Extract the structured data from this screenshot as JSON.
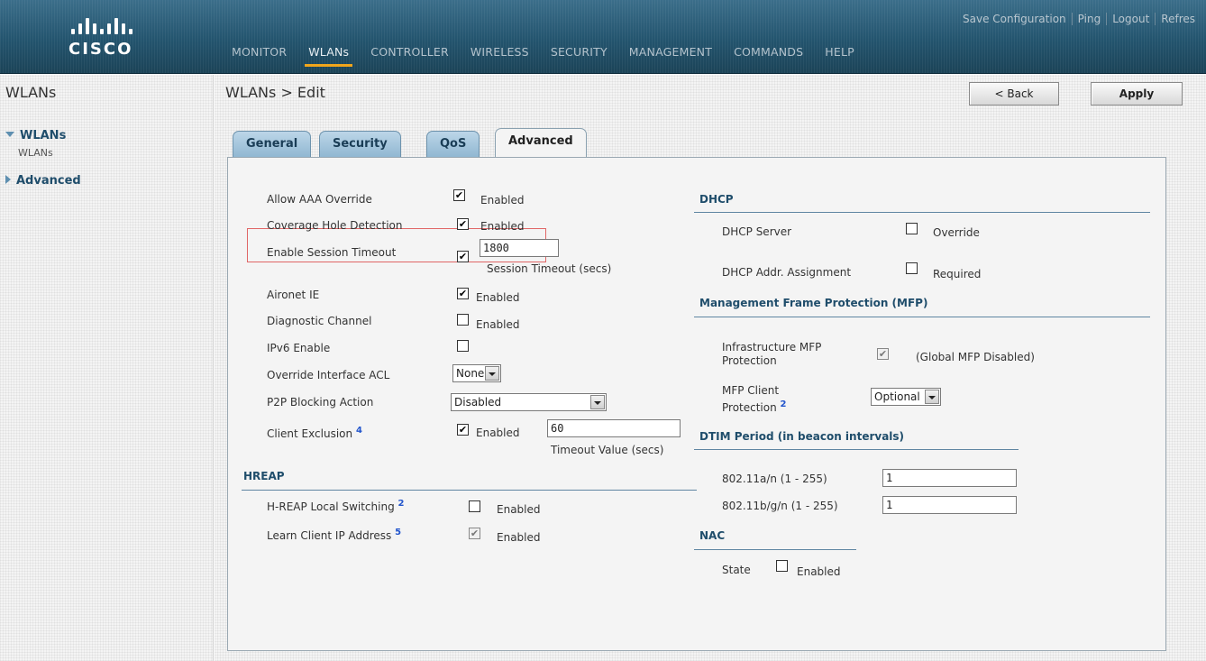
{
  "header": {
    "logo_text": "CISCO",
    "top_links": [
      "Save Configuration",
      "Ping",
      "Logout",
      "Refres"
    ],
    "nav": [
      "MONITOR",
      "WLANs",
      "CONTROLLER",
      "WIRELESS",
      "SECURITY",
      "MANAGEMENT",
      "COMMANDS",
      "HELP"
    ],
    "active_nav": "WLANs",
    "accent_color": "#f0a51c"
  },
  "sidebar": {
    "title": "WLANs",
    "groups": [
      {
        "label": "WLANs",
        "expanded": true,
        "items": [
          "WLANs"
        ]
      },
      {
        "label": "Advanced",
        "expanded": false,
        "items": []
      }
    ]
  },
  "page": {
    "title": "WLANs > Edit",
    "back_label": "< Back",
    "apply_label": "Apply"
  },
  "tabs": [
    "General",
    "Security",
    "QoS",
    "Advanced"
  ],
  "active_tab": "Advanced",
  "left": {
    "allow_aaa": {
      "label": "Allow AAA Override",
      "checked": true,
      "text": "Enabled"
    },
    "coverage_hole": {
      "label": "Coverage Hole Detection",
      "checked": true,
      "text": "Enabled"
    },
    "session_timeout": {
      "label": "Enable Session Timeout",
      "checked": true,
      "value": "1800",
      "caption": "Session Timeout (secs)"
    },
    "aironet": {
      "label": "Aironet IE",
      "checked": true,
      "text": "Enabled"
    },
    "diagnostic": {
      "label": "Diagnostic Channel",
      "checked": false,
      "text": "Enabled"
    },
    "ipv6": {
      "label": "IPv6 Enable",
      "checked": false
    },
    "override_acl": {
      "label": "Override Interface ACL",
      "value": "None"
    },
    "p2p": {
      "label": "P2P Blocking Action",
      "value": "Disabled"
    },
    "client_exclusion": {
      "label": "Client Exclusion",
      "help": "4",
      "checked": true,
      "text": "Enabled",
      "value": "60",
      "caption": "Timeout Value (secs)"
    }
  },
  "hreap": {
    "title": "HREAP",
    "local_switching": {
      "label": "H-REAP Local Switching",
      "help": "2",
      "checked": false,
      "text": "Enabled"
    },
    "learn_ip": {
      "label": "Learn Client IP Address",
      "help": "5",
      "checked": true,
      "disabled": true,
      "text": "Enabled"
    }
  },
  "dhcp": {
    "title": "DHCP",
    "server": {
      "label": "DHCP Server",
      "checked": false,
      "text": "Override"
    },
    "assignment": {
      "label": "DHCP Addr. Assignment",
      "checked": false,
      "text": "Required"
    }
  },
  "mfp": {
    "title": "Management Frame Protection (MFP)",
    "infra_line1": "Infrastructure MFP",
    "infra_line2": "Protection",
    "infra_checked": true,
    "infra_note": "(Global MFP Disabled)",
    "client_line1": "MFP Client",
    "client_line2": "Protection",
    "client_help": "2",
    "client_value": "Optional"
  },
  "dtim": {
    "title": "DTIM Period (in beacon intervals)",
    "a_label": "802.11a/n (1 - 255)",
    "a_value": "1",
    "b_label": "802.11b/g/n (1 - 255)",
    "b_value": "1"
  },
  "nac": {
    "title": "NAC",
    "state_label": "State",
    "checked": false,
    "text": "Enabled"
  }
}
